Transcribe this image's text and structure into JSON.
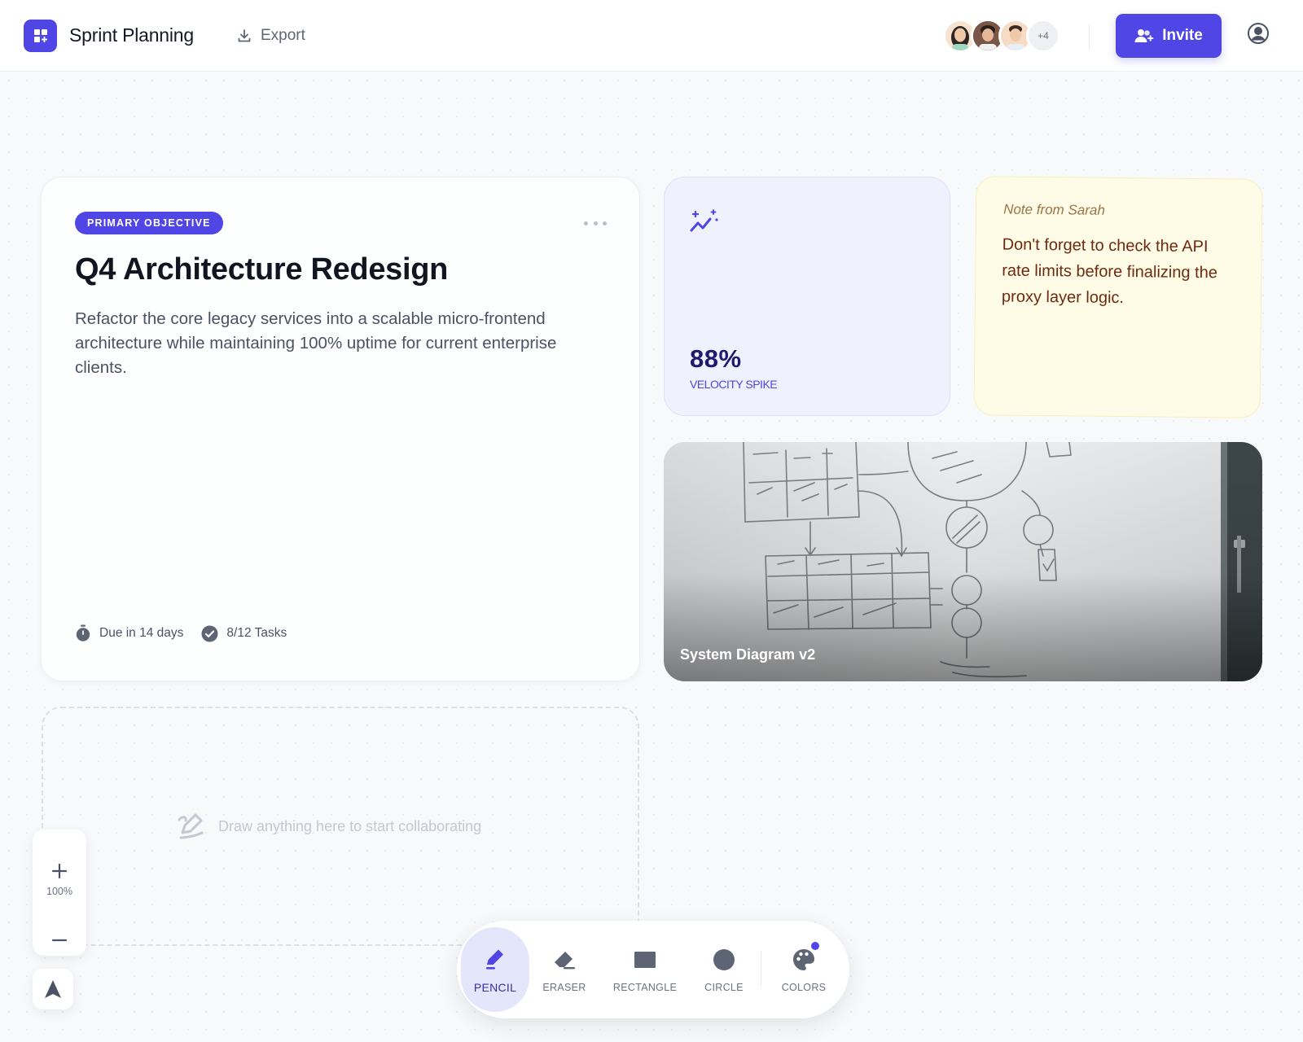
{
  "header": {
    "app_title": "Sprint Planning",
    "export_label": "Export",
    "extra_collaborators": "+4",
    "invite_label": "Invite"
  },
  "objective": {
    "badge": "PRIMARY OBJECTIVE",
    "title": "Q4 Architecture Redesign",
    "description": "Refactor the core legacy services into a scalable micro-frontend architecture while maintaining 100% uptime for current enterprise clients.",
    "due": "Due in 14 days",
    "tasks": "8/12 Tasks"
  },
  "velocity": {
    "value": "88%",
    "label": "VELOCITY SPIKE"
  },
  "note": {
    "title": "Note from Sarah",
    "body": "Don't forget to check the API rate limits before finalizing the proxy layer logic."
  },
  "diagram": {
    "caption": "System Diagram v2"
  },
  "canvas": {
    "hint": "Draw anything here to start collaborating"
  },
  "zoom": {
    "level": "100%"
  },
  "toolbar": {
    "tools": [
      {
        "label": "PENCIL",
        "icon": "pencil-icon",
        "active": true
      },
      {
        "label": "ERASER",
        "icon": "eraser-icon",
        "active": false
      },
      {
        "label": "RECTANGLE",
        "icon": "rectangle-icon",
        "active": false
      },
      {
        "label": "CIRCLE",
        "icon": "circle-icon",
        "active": false
      },
      {
        "label": "COLORS",
        "icon": "palette-icon",
        "active": false
      }
    ]
  },
  "colors": {
    "accent": "#4f46e5",
    "note_text": "#6e2a10",
    "velocity_bg": "#eff1fd",
    "note_bg": "#fefbe7"
  }
}
